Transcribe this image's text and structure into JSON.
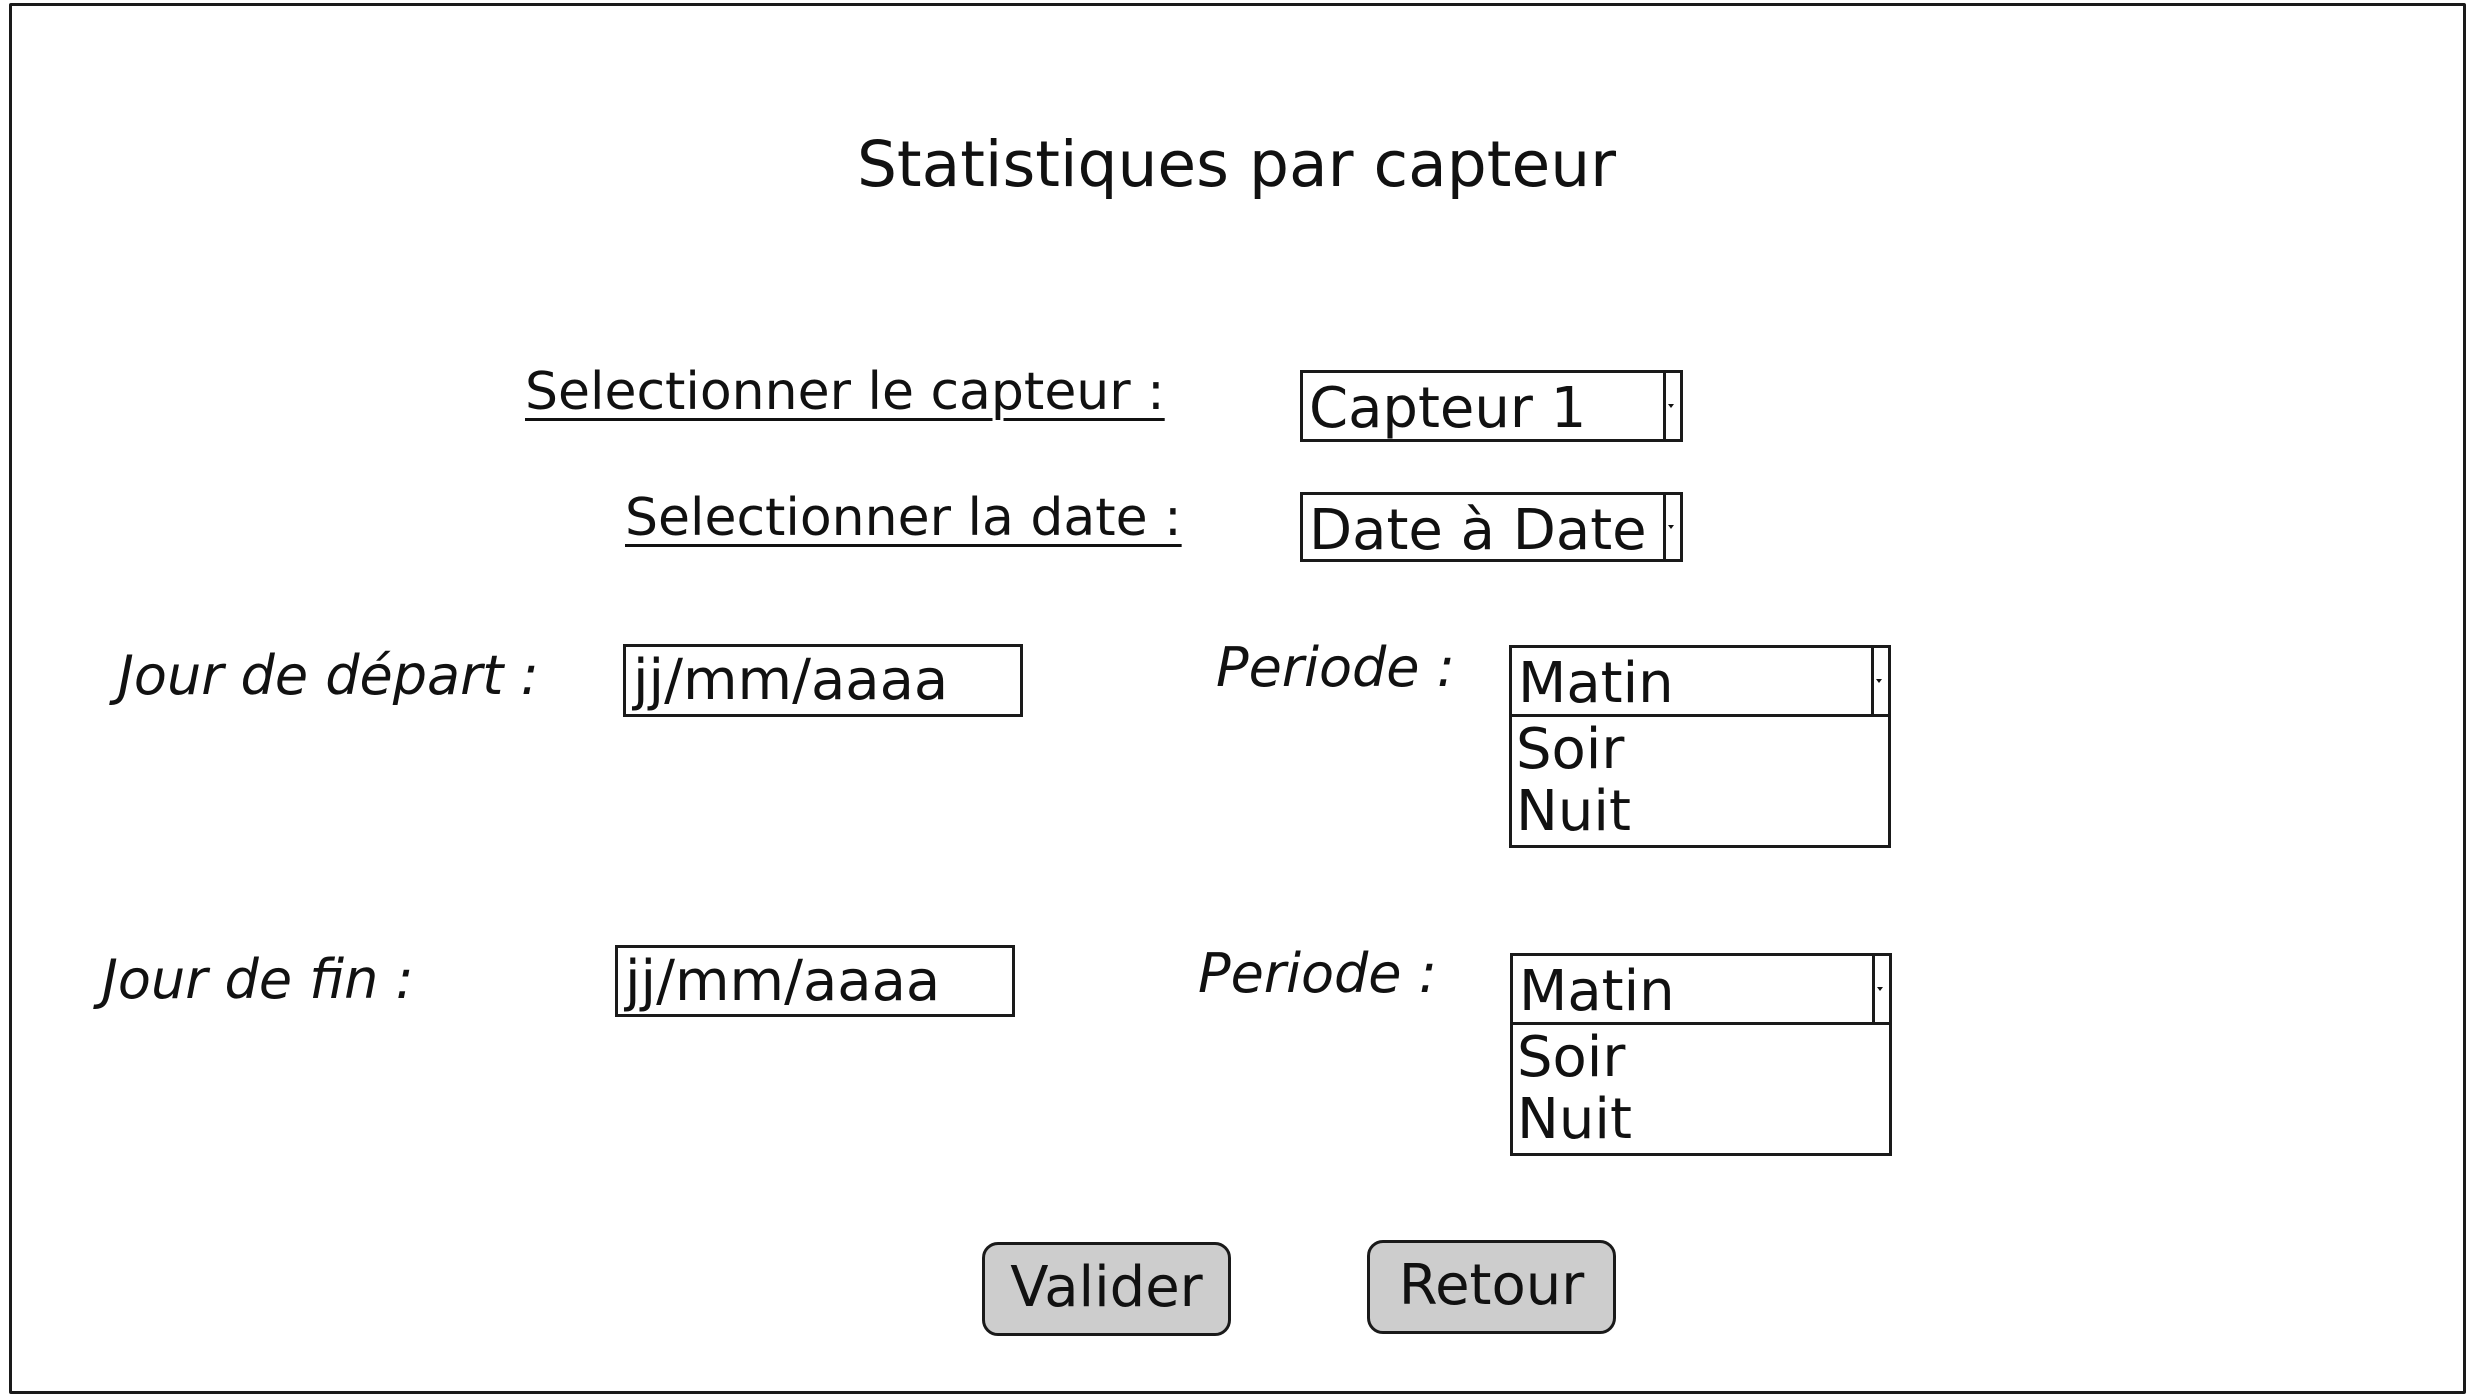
{
  "title": "Statistiques par capteur",
  "sensor": {
    "label": "Selectionner le capteur :",
    "selected": "Capteur 1"
  },
  "date": {
    "label": "Selectionner la date :",
    "selected": "Date à Date"
  },
  "start": {
    "label": "Jour de départ :",
    "placeholder": "jj/mm/aaaa",
    "period_label": "Periode :",
    "period_selected": "Matin",
    "period_options": [
      "Soir",
      "Nuit"
    ]
  },
  "end": {
    "label": "Jour de fin :",
    "placeholder": "jj/mm/aaaa",
    "period_label": "Periode :",
    "period_selected": "Matin",
    "period_options": [
      "Soir",
      "Nuit"
    ]
  },
  "buttons": {
    "validate": "Valider",
    "back": "Retour"
  }
}
